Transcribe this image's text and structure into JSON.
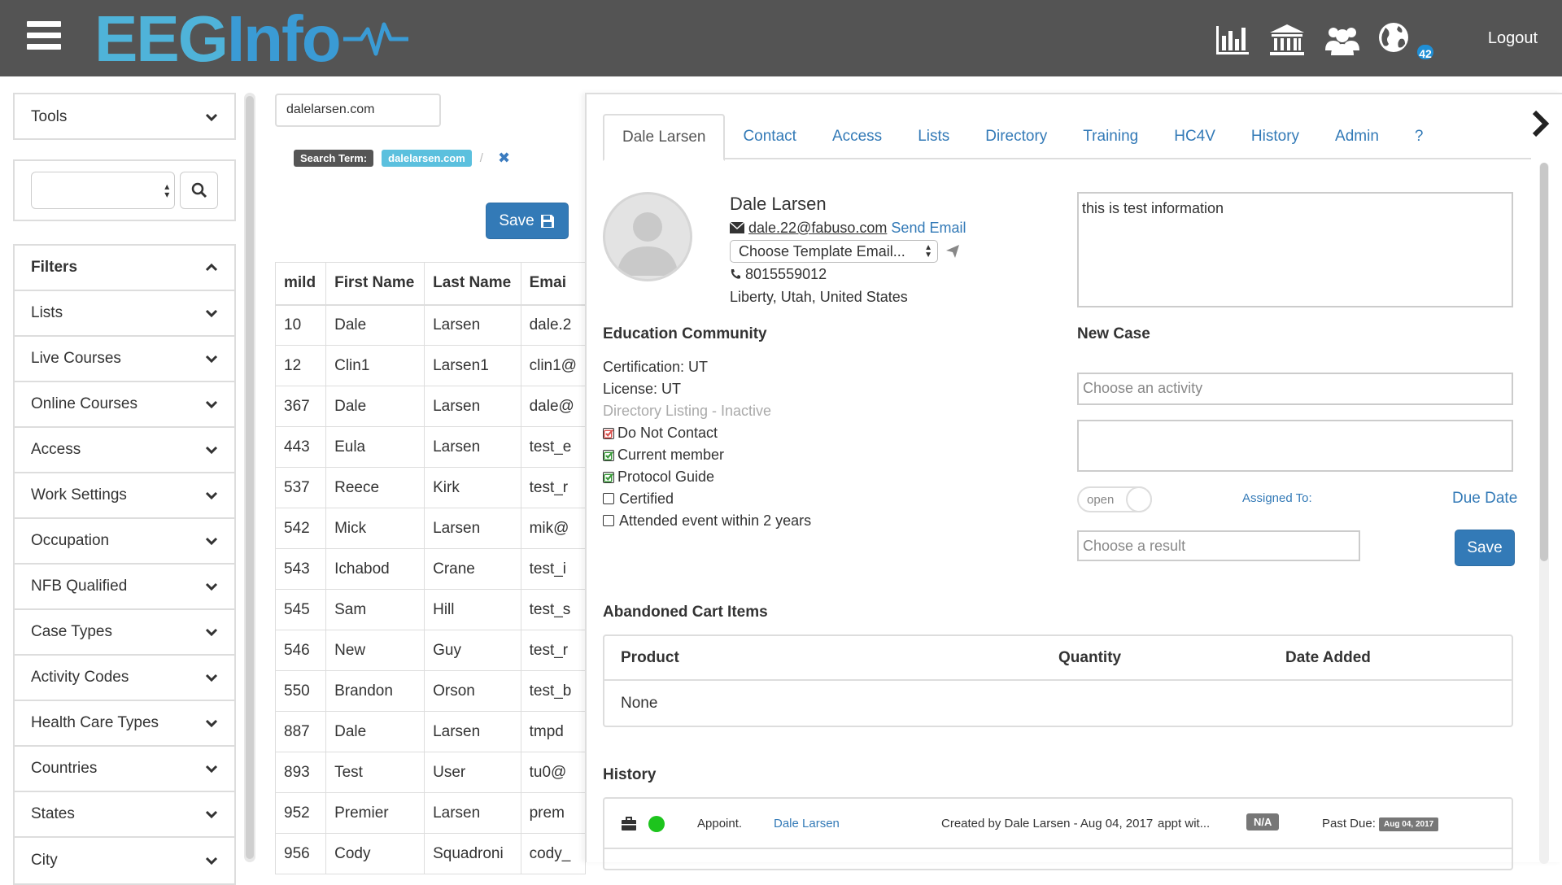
{
  "header": {
    "logo_eeg": "EEG",
    "logo_info": "Info",
    "icons": [
      "chart-icon",
      "institution-icon",
      "users-icon",
      "globe-icon"
    ],
    "notification_count": "42",
    "logout_label": "Logout"
  },
  "sidebar": {
    "tools_label": "Tools",
    "filters_label": "Filters",
    "filter_items": [
      {
        "label": "Lists"
      },
      {
        "label": "Live Courses"
      },
      {
        "label": "Online Courses"
      },
      {
        "label": "Access"
      },
      {
        "label": "Work Settings"
      },
      {
        "label": "Occupation"
      },
      {
        "label": "NFB Qualified"
      },
      {
        "label": "Case Types"
      },
      {
        "label": "Activity Codes"
      },
      {
        "label": "Health Care Types"
      },
      {
        "label": "Countries"
      },
      {
        "label": "States"
      },
      {
        "label": "City"
      }
    ]
  },
  "search": {
    "domain_value": "dalelarsen.com",
    "term_label": "Search Term:",
    "term_value": "dalelarsen.com",
    "separator": "/",
    "save_label": "Save"
  },
  "table": {
    "headers": [
      "mild",
      "First Name",
      "Last Name",
      "Emai"
    ],
    "rows": [
      [
        "10",
        "Dale",
        "Larsen",
        "dale.2"
      ],
      [
        "12",
        "Clin1",
        "Larsen1",
        "clin1@"
      ],
      [
        "367",
        "Dale",
        "Larsen",
        "dale@"
      ],
      [
        "443",
        "Eula",
        "Larsen",
        "test_e"
      ],
      [
        "537",
        "Reece",
        "Kirk",
        "test_r"
      ],
      [
        "542",
        "Mick",
        "Larsen",
        "mik@"
      ],
      [
        "543",
        "Ichabod",
        "Crane",
        "test_i"
      ],
      [
        "545",
        "Sam",
        "Hill",
        "test_s"
      ],
      [
        "546",
        "New",
        "Guy",
        "test_r"
      ],
      [
        "550",
        "Brandon",
        "Orson",
        "test_b"
      ],
      [
        "887",
        "Dale",
        "Larsen",
        "tmpd"
      ],
      [
        "893",
        "Test",
        "User",
        "tu0@"
      ],
      [
        "952",
        "Premier",
        "Larsen",
        "prem"
      ],
      [
        "956",
        "Cody",
        "Squadroni",
        "cody_"
      ]
    ]
  },
  "panel": {
    "tabs": [
      {
        "label": "Dale Larsen",
        "active": true
      },
      {
        "label": "Contact"
      },
      {
        "label": "Access"
      },
      {
        "label": "Lists"
      },
      {
        "label": "Directory"
      },
      {
        "label": "Training"
      },
      {
        "label": "HC4V"
      },
      {
        "label": "History"
      },
      {
        "label": "Admin"
      },
      {
        "label": "?"
      }
    ],
    "contact": {
      "name": "Dale Larsen",
      "email": "dale.22@fabuso.com",
      "send_email_label": "Send Email",
      "template_select": "Choose Template Email...",
      "phone": "8015559012",
      "location": "Liberty, Utah, United States"
    },
    "notes": "this is test information",
    "education": {
      "title": "Education Community",
      "certification": "Certification: UT",
      "license": "License: UT",
      "directory_listing": "Directory Listing - Inactive",
      "checks": [
        {
          "label": "Do Not Contact",
          "state": "red"
        },
        {
          "label": "Current member",
          "state": "green"
        },
        {
          "label": "Protocol Guide",
          "state": "green"
        },
        {
          "label": "Certified",
          "state": "empty"
        },
        {
          "label": "Attended event within 2 years",
          "state": "empty"
        }
      ]
    },
    "new_case": {
      "title": "New Case",
      "activity_placeholder": "Choose an activity",
      "toggle_label": "open",
      "assigned_label": "Assigned To:",
      "due_date_label": "Due Date",
      "result_placeholder": "Choose a result",
      "save_label": "Save"
    },
    "cart": {
      "title": "Abandoned Cart Items",
      "headers": [
        "Product",
        "Quantity",
        "Date Added"
      ],
      "empty_text": "None"
    },
    "history": {
      "title": "History",
      "rows": [
        {
          "type": "Appoint.",
          "person": "Dale Larsen",
          "created": "Created by Dale Larsen - Aug 04, 2017",
          "note": "appt wit...",
          "status": "N/A",
          "past_due_label": "Past Due:",
          "past_due_date": "Aug 04, 2017"
        }
      ]
    }
  },
  "colors": {
    "topbar": "#545454",
    "accent": "#337ab7",
    "logo_light": "#4fb3d9",
    "logo_dark": "#3a9bd5",
    "badge_info": "#5bc0de",
    "status_green": "#1dc41d",
    "status_red": "#d9534f"
  }
}
